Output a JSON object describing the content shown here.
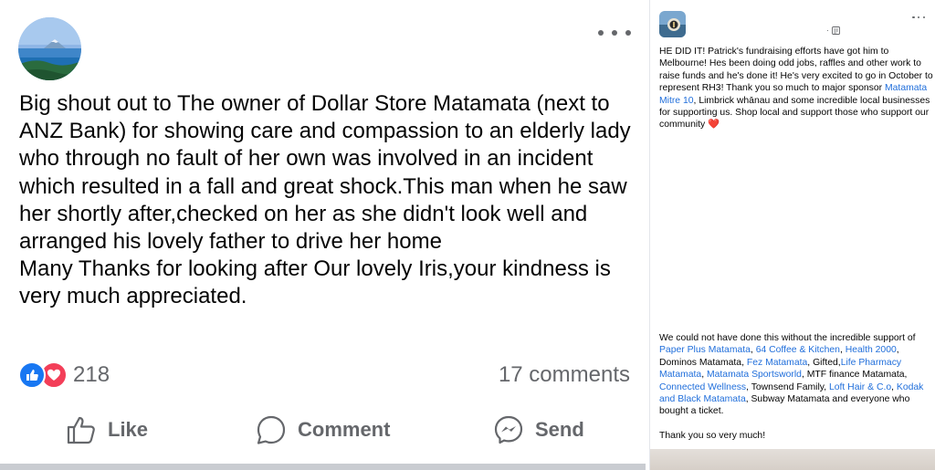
{
  "left_post": {
    "body_lines": [
      "Big shout out to The owner of Dollar Store Matamata (next to ANZ Bank) for showing care and compassion to an elderly lady who through no fault of her own was involved in an incident which resulted in a fall and great shock.This man when he saw her shortly after,checked on her as she didn't  look well and arranged his lovely father to drive her home",
      "Many Thanks for looking after Our lovely Iris,your kindness is very much appreciated."
    ],
    "reaction_count": "218",
    "comments_count": "17 comments",
    "actions": {
      "like": "Like",
      "comment": "Comment",
      "send": "Send"
    }
  },
  "right_post": {
    "meta_separator": "·",
    "top_paragraph": {
      "text_1": "HE DID IT! Patrick's fundraising efforts have got him to Melbourne! Hes been doing odd jobs, raffles and other work to raise funds and he's done it! He's very excited to go in October to represent RH3! Thank you so much to major sponsor ",
      "link_1": "Matamata Mitre 10",
      "text_2": ", Limbrick whānau and some incredible local businesses for supporting us. Shop local and support those who support our community ",
      "emoji": "❤️"
    },
    "bottom_paragraph": {
      "t1": "We could not have done this without the incredible support of ",
      "l1": "Paper Plus Matamata",
      "t2": ", ",
      "l2": "64 Coffee & Kitchen",
      "t3": ", ",
      "l3": "Health 2000",
      "t4": ", Dominos Matamata, ",
      "l4": "Fez Matamata",
      "t5": ", Gifted,",
      "l5": "Life Pharmacy Matamata",
      "t6": ", ",
      "l6": "Matamata Sportsworld",
      "t7": ", MTF finance Matamata, ",
      "l7": "Connected Wellness",
      "t8": ", Townsend Family, ",
      "l8": "Loft Hair & C.o",
      "t9": ", ",
      "l9": "Kodak and Black Matamata",
      "t10": ", Subway Matamata and everyone who bought a ticket."
    },
    "closing": "Thank you so very much!"
  },
  "colors": {
    "text": "#050505",
    "secondary": "#65676b",
    "link": "#216fdb",
    "like_blue": "#1877f2",
    "love_red": "#f33e58"
  },
  "icons": [
    "more-options-icon",
    "like-reaction-icon",
    "love-reaction-icon",
    "thumbs-up-icon",
    "comment-bubble-icon",
    "messenger-icon",
    "globe-icon"
  ]
}
